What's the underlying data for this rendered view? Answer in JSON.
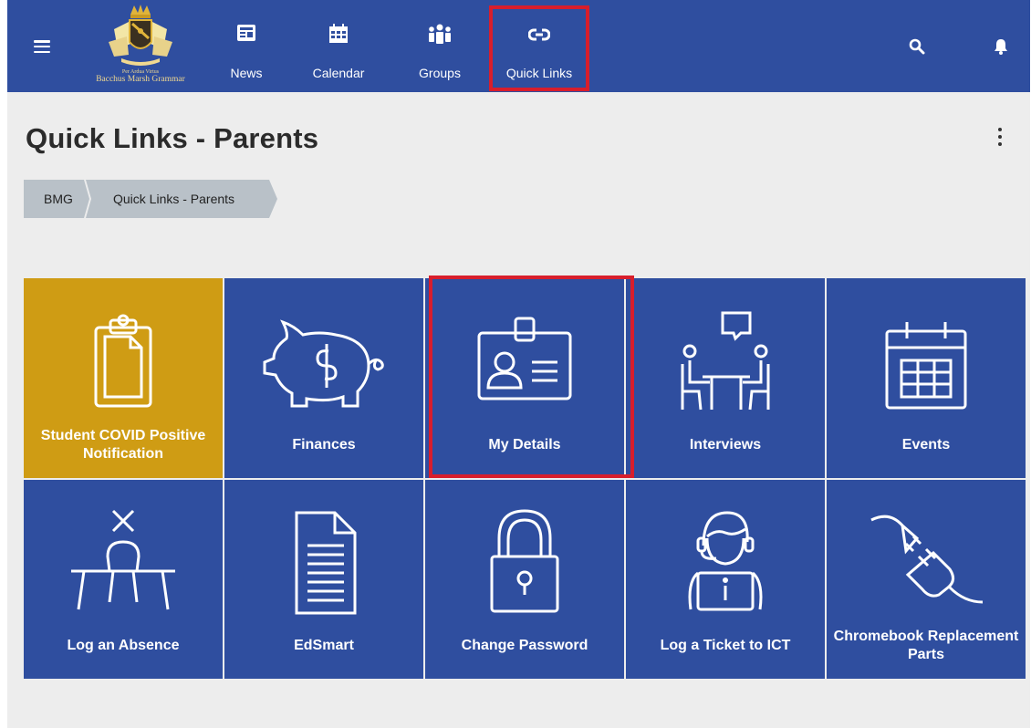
{
  "brand": {
    "tagline": "Per Ardua Virtus",
    "name": "Bacchus Marsh Grammar"
  },
  "nav": {
    "items": [
      {
        "label": "News",
        "icon": "news-icon"
      },
      {
        "label": "Calendar",
        "icon": "calendar-icon"
      },
      {
        "label": "Groups",
        "icon": "groups-icon"
      },
      {
        "label": "Quick Links",
        "icon": "link-icon"
      }
    ],
    "highlighted": "Quick Links"
  },
  "page": {
    "title": "Quick Links - Parents"
  },
  "breadcrumb": [
    "BMG",
    "Quick Links - Parents"
  ],
  "tiles": [
    {
      "label": "Student COVID Positive Notification",
      "icon": "clipboard-icon",
      "color": "#cf9c14"
    },
    {
      "label": "Finances",
      "icon": "piggy-bank-icon",
      "color": "#2f4e9f"
    },
    {
      "label": "My Details",
      "icon": "id-card-icon",
      "color": "#2f4e9f",
      "highlighted": true
    },
    {
      "label": "Interviews",
      "icon": "meeting-icon",
      "color": "#2f4e9f"
    },
    {
      "label": "Events",
      "icon": "calendar-icon",
      "color": "#2f4e9f"
    },
    {
      "label": "Log an Absence",
      "icon": "empty-desk-icon",
      "color": "#2f4e9f"
    },
    {
      "label": "EdSmart",
      "icon": "document-icon",
      "color": "#2f4e9f"
    },
    {
      "label": "Change Password",
      "icon": "padlock-icon",
      "color": "#2f4e9f"
    },
    {
      "label": "Log a Ticket to ICT",
      "icon": "helpdesk-icon",
      "color": "#2f4e9f"
    },
    {
      "label": "Chromebook Replacement Parts",
      "icon": "plug-icon",
      "color": "#2f4e9f"
    }
  ],
  "colors": {
    "nav_bar": "#2f4e9f",
    "tile_blue": "#2f4e9f",
    "tile_gold": "#cf9c14",
    "highlight": "#d81e2c",
    "background": "#ededed"
  }
}
